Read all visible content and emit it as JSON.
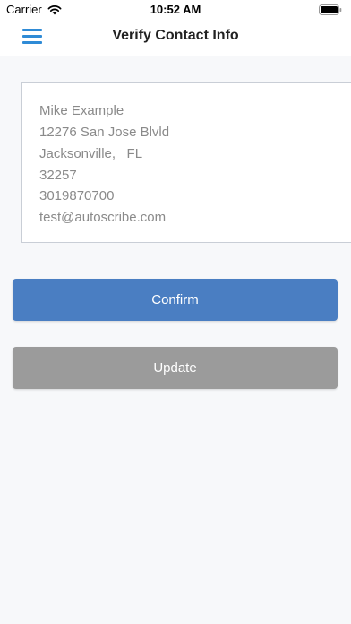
{
  "status_bar": {
    "carrier": "Carrier",
    "time": "10:52 AM"
  },
  "header": {
    "title": "Verify Contact Info",
    "menu_icon": "hamburger-menu-icon"
  },
  "contact": {
    "name": "Mike Example",
    "street": "12276 San Jose Blvld",
    "city_state": "Jacksonville,   FL",
    "zip": "32257",
    "phone": "3019870700",
    "email": "test@autoscribe.com"
  },
  "actions": {
    "confirm_label": "Confirm",
    "update_label": "Update"
  },
  "colors": {
    "confirm": "#4a7ec2",
    "update": "#9b9b9b",
    "accent": "#2f8bd6"
  }
}
